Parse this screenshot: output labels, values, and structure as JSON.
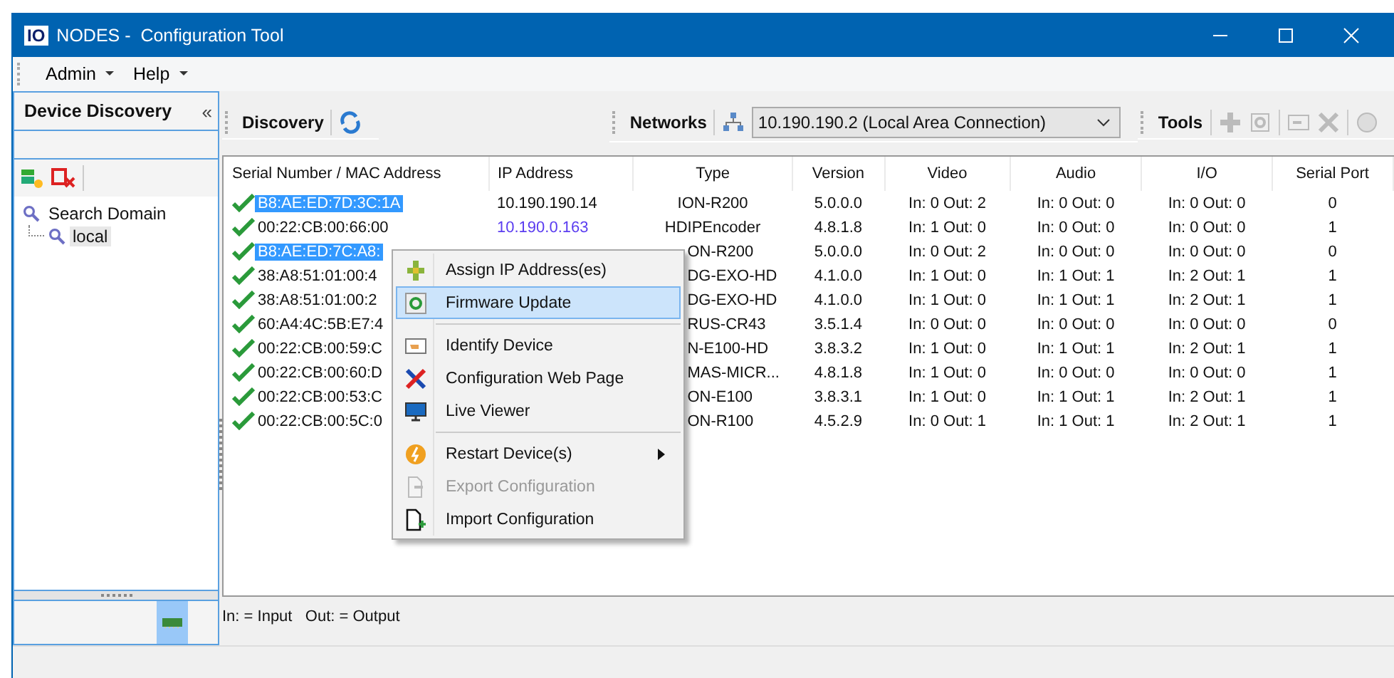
{
  "window": {
    "title": "NODES -  Configuration Tool",
    "logo": "IO"
  },
  "menu_bar": [
    "Admin",
    "Help"
  ],
  "sidebar": {
    "title": "Device Discovery",
    "collapse": "«",
    "tree": [
      {
        "label": "Search Domain",
        "children": [
          {
            "label": "local",
            "selected": true
          }
        ]
      }
    ]
  },
  "toolbar": {
    "discovery_label": "Discovery",
    "networks_label": "Networks",
    "network": "10.190.190.2 (Local Area Connection)",
    "tools_label": "Tools"
  },
  "table": {
    "columns": [
      "Serial Number / MAC Address",
      "IP Address",
      "Type",
      "Version",
      "Video",
      "Audio",
      "I/O",
      "Serial Port"
    ],
    "rows": [
      {
        "selected": true,
        "covered": false,
        "ip_link": false,
        "serial": "B8:AE:ED:7D:3C:1A",
        "ip": "10.190.190.14",
        "type": "ION-R200",
        "version": "5.0.0.0",
        "video": "In: 0  Out: 2",
        "audio": "In: 0  Out: 0",
        "io": "In: 0  Out: 0",
        "serial_port": "0"
      },
      {
        "selected": false,
        "covered": false,
        "ip_link": true,
        "serial": "00:22:CB:00:66:00",
        "ip": "10.190.0.163",
        "type": "HDIPEncoder",
        "version": "4.8.1.8",
        "video": "In: 1  Out: 0",
        "audio": "In: 0  Out: 0",
        "io": "In: 0  Out: 0",
        "serial_port": "1"
      },
      {
        "selected": true,
        "covered": true,
        "serial": "B8:AE:ED:7C:A8:",
        "type": "ON-R200",
        "version": "5.0.0.0",
        "video": "In: 0  Out: 2",
        "audio": "In: 0  Out: 0",
        "io": "In: 0  Out: 0",
        "serial_port": "0"
      },
      {
        "selected": false,
        "covered": true,
        "serial": "38:A8:51:01:00:4",
        "type": "DG-EXO-HD",
        "version": "4.1.0.0",
        "video": "In: 1  Out: 0",
        "audio": "In: 1  Out: 1",
        "io": "In: 2  Out: 1",
        "serial_port": "1"
      },
      {
        "selected": false,
        "covered": true,
        "serial": "38:A8:51:01:00:2",
        "type": "DG-EXO-HD",
        "version": "4.1.0.0",
        "video": "In: 1  Out: 0",
        "audio": "In: 1  Out: 1",
        "io": "In: 2  Out: 1",
        "serial_port": "1"
      },
      {
        "selected": false,
        "covered": true,
        "serial": "60:A4:4C:5B:E7:4",
        "type": "RUS-CR43",
        "version": "3.5.1.4",
        "video": "In: 0  Out: 0",
        "audio": "In: 0  Out: 0",
        "io": "In: 0  Out: 0",
        "serial_port": "0"
      },
      {
        "selected": false,
        "covered": true,
        "serial": "00:22:CB:00:59:C",
        "type": "N-E100-HD",
        "version": "3.8.3.2",
        "video": "In: 1  Out: 0",
        "audio": "In: 1  Out: 1",
        "io": "In: 2  Out: 1",
        "serial_port": "1"
      },
      {
        "selected": false,
        "covered": true,
        "serial": "00:22:CB:00:60:D",
        "type": "MAS-MICR...",
        "version": "4.8.1.8",
        "video": "In: 1  Out: 0",
        "audio": "In: 0  Out: 0",
        "io": "In: 0  Out: 0",
        "serial_port": "1"
      },
      {
        "selected": false,
        "covered": true,
        "serial": "00:22:CB:00:53:C",
        "type": "ON-E100",
        "version": "3.8.3.1",
        "video": "In: 1  Out: 0",
        "audio": "In: 1  Out: 1",
        "io": "In: 2  Out: 1",
        "serial_port": "1"
      },
      {
        "selected": false,
        "covered": true,
        "serial": "00:22:CB:00:5C:0",
        "type": "ON-R100",
        "version": "4.5.2.9",
        "video": "In: 0  Out: 1",
        "audio": "In: 1  Out: 1",
        "io": "In: 2  Out: 1",
        "serial_port": "1"
      }
    ]
  },
  "legend": "In: = Input   Out: = Output",
  "context_menu": [
    {
      "kind": "item",
      "label": "Assign IP Address(es)",
      "selected": false,
      "disabled": false,
      "submenu": false
    },
    {
      "kind": "item",
      "label": "Firmware Update",
      "selected": true,
      "disabled": false,
      "submenu": false
    },
    {
      "kind": "separator"
    },
    {
      "kind": "item",
      "label": "Identify Device",
      "selected": false,
      "disabled": false,
      "submenu": false
    },
    {
      "kind": "item",
      "label": "Configuration Web Page",
      "selected": false,
      "disabled": false,
      "submenu": false
    },
    {
      "kind": "item",
      "label": "Live Viewer",
      "selected": false,
      "disabled": false,
      "submenu": false
    },
    {
      "kind": "separator"
    },
    {
      "kind": "item",
      "label": "Restart Device(s)",
      "selected": false,
      "disabled": false,
      "submenu": true
    },
    {
      "kind": "item",
      "label": "Export Configuration",
      "selected": false,
      "disabled": true,
      "submenu": false
    },
    {
      "kind": "item",
      "label": "Import Configuration",
      "selected": false,
      "disabled": false,
      "submenu": false
    }
  ]
}
